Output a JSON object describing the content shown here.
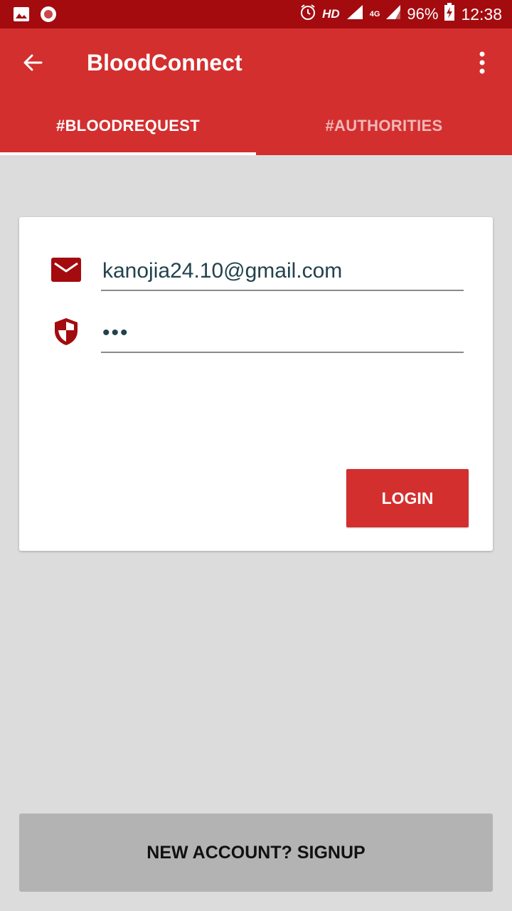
{
  "status_bar": {
    "network": "HD",
    "network_type": "4G",
    "battery": "96%",
    "time": "12:38",
    "icons": [
      "image-icon",
      "record-icon",
      "alarm-icon",
      "signal-icon",
      "battery-icon"
    ]
  },
  "app_bar": {
    "title": "BloodConnect",
    "back_icon": "arrow-left-icon",
    "menu_icon": "more-vert-icon"
  },
  "tabs": [
    {
      "label": "#BLOODREQUEST",
      "active": true
    },
    {
      "label": "#AUTHORITIES",
      "active": false
    }
  ],
  "login_form": {
    "email_value": "kanojia24.10@gmail.com",
    "password_value": "•••",
    "email_icon": "mail-icon",
    "password_icon": "shield-icon",
    "login_label": "LOGIN"
  },
  "signup": {
    "label": "NEW ACCOUNT? SIGNUP"
  },
  "colors": {
    "primary": "#d32f2f",
    "primary_dark": "#a30b0f",
    "icon": "#a30b0f",
    "background": "#dcdcdc"
  }
}
